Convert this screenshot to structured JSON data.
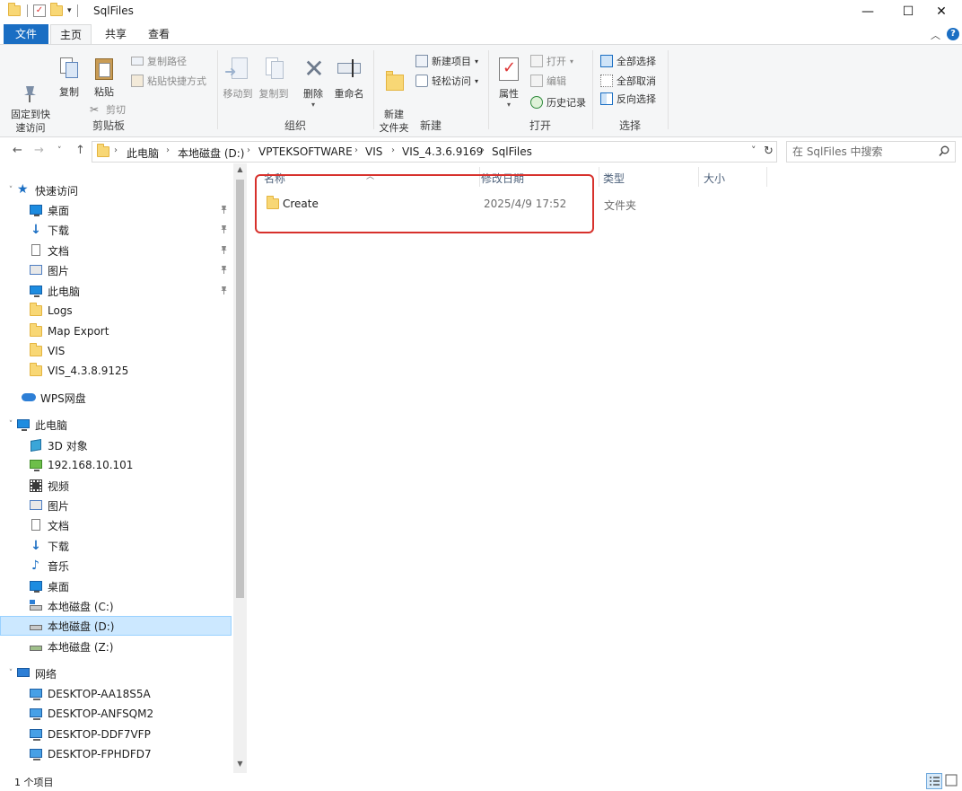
{
  "window": {
    "title": "SqlFiles",
    "minimize": "—",
    "maximize": "☐",
    "close": "✕"
  },
  "ribbon_tabs": {
    "file": "文件",
    "home": "主页",
    "share": "共享",
    "view": "查看"
  },
  "ribbon": {
    "clipboard": {
      "label": "剪贴板",
      "pin_quick": "固定到快\n速访问",
      "copy": "复制",
      "paste": "粘贴",
      "copy_path": "复制路径",
      "paste_shortcut": "粘贴快捷方式",
      "cut": "剪切"
    },
    "organize": {
      "label": "组织",
      "move_to": "移动到",
      "copy_to": "复制到",
      "delete": "删除",
      "rename": "重命名"
    },
    "new": {
      "label": "新建",
      "new_folder": "新建\n文件夹",
      "new_item": "新建项目",
      "easy_access": "轻松访问"
    },
    "open": {
      "label": "打开",
      "properties": "属性",
      "open": "打开",
      "edit": "编辑",
      "history": "历史记录"
    },
    "select": {
      "label": "选择",
      "select_all": "全部选择",
      "select_none": "全部取消",
      "invert": "反向选择"
    }
  },
  "address": {
    "crumbs": [
      "此电脑",
      "本地磁盘 (D:)",
      "VPTEKSOFTWARE",
      "VIS",
      "VIS_4.3.6.9169",
      "SqlFiles"
    ],
    "search_placeholder": "在 SqlFiles 中搜索"
  },
  "nav": {
    "quick_access": "快速访问",
    "quick_items": [
      "桌面",
      "下载",
      "文档",
      "图片",
      "此电脑",
      "Logs",
      "Map Export",
      "VIS",
      "VIS_4.3.8.9125"
    ],
    "wps": "WPS网盘",
    "this_pc": "此电脑",
    "pc_items": [
      "3D 对象",
      "192.168.10.101",
      "视频",
      "图片",
      "文档",
      "下载",
      "音乐",
      "桌面",
      "本地磁盘 (C:)",
      "本地磁盘 (D:)",
      "本地磁盘 (Z:)"
    ],
    "network": "网络",
    "network_items": [
      "DESKTOP-AA18S5A",
      "DESKTOP-ANFSQM2",
      "DESKTOP-DDF7VFP",
      "DESKTOP-FPHDFD7"
    ]
  },
  "columns": {
    "name": "名称",
    "modified": "修改日期",
    "type": "类型",
    "size": "大小"
  },
  "files": [
    {
      "name": "Create",
      "modified": "2025/4/9 17:52",
      "type": "文件夹",
      "size": ""
    }
  ],
  "status": {
    "count": "1 个项目"
  },
  "colors": {
    "accent": "#1a6ec3",
    "selection": "#cce8ff",
    "highlight_box": "#d7312c"
  }
}
